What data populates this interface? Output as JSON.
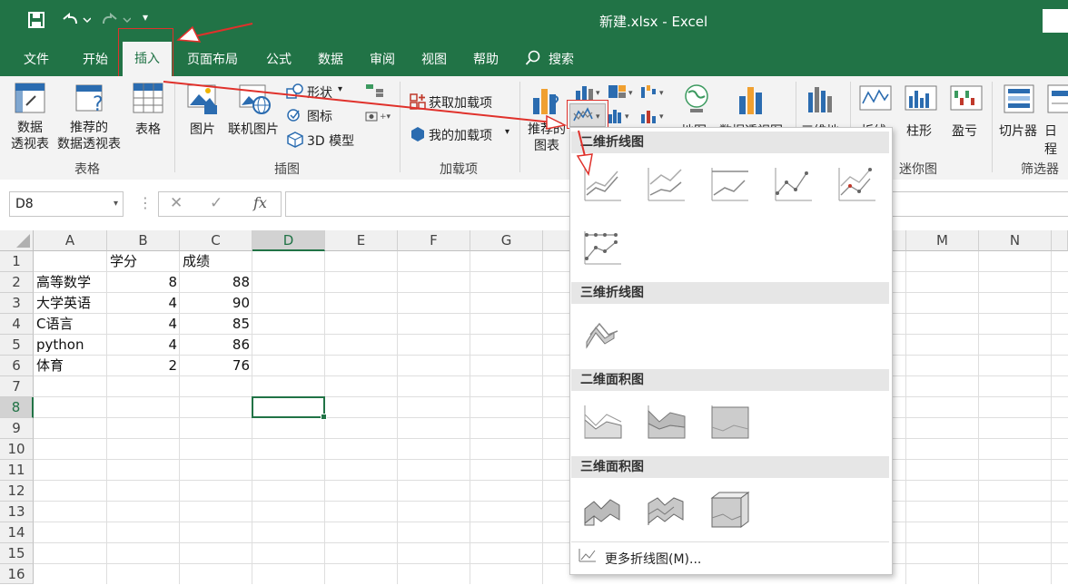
{
  "window": {
    "title": "新建.xlsx  -  Excel"
  },
  "qat": {
    "save": "save-icon",
    "undo": "undo-icon",
    "redo": "redo-icon"
  },
  "tabs": [
    "文件",
    "开始",
    "插入",
    "页面布局",
    "公式",
    "数据",
    "审阅",
    "视图",
    "帮助",
    "搜索"
  ],
  "ribbon": {
    "table_group": {
      "label": "表格",
      "pivot": "数据\n透视表",
      "recommended_pivot": "推荐的\n数据透视表",
      "table": "表格"
    },
    "illustrations_group": {
      "label": "插图",
      "picture": "图片",
      "online_picture": "联机图片",
      "shapes": "形状",
      "icons": "图标",
      "model3d": "3D 模型"
    },
    "addins_group": {
      "label": "加载项",
      "get": "获取加载项",
      "my": "我的加载项"
    },
    "charts_group": {
      "recommended": "推荐的\n图表",
      "map": "地图",
      "pivot_chart": "数据透视图",
      "three_d": "三维地"
    },
    "spark_group": {
      "label": "迷你图",
      "line": "折线",
      "column": "柱形",
      "winloss": "盈亏"
    },
    "filter_group": {
      "label": "筛选器",
      "slicer": "切片器",
      "timeline": "日程"
    }
  },
  "formula_bar": {
    "namebox": "D8",
    "fx": "fx"
  },
  "columns": [
    "A",
    "B",
    "C",
    "D",
    "E",
    "F",
    "G",
    "M",
    "N"
  ],
  "rows": [
    "1",
    "2",
    "3",
    "4",
    "5",
    "6",
    "7",
    "8",
    "9",
    "10",
    "11",
    "12",
    "13",
    "14",
    "15",
    "16"
  ],
  "cells": {
    "B1": "学分",
    "C1": "成绩",
    "A2": "高等数学",
    "B2": "8",
    "C2": "88",
    "A3": "大学英语",
    "B3": "4",
    "C3": "90",
    "A4": "C语言",
    "B4": "4",
    "C4": "85",
    "A5": "python",
    "B5": "4",
    "C5": "86",
    "A6": "体育",
    "B6": "2",
    "C6": "76"
  },
  "dropdown": {
    "sec1": "二维折线图",
    "sec2": "三维折线图",
    "sec3": "二维面积图",
    "sec4": "三维面积图",
    "more": "更多折线图(M)..."
  },
  "colors": {
    "accent": "#217346",
    "annotation": "#e0312b"
  }
}
